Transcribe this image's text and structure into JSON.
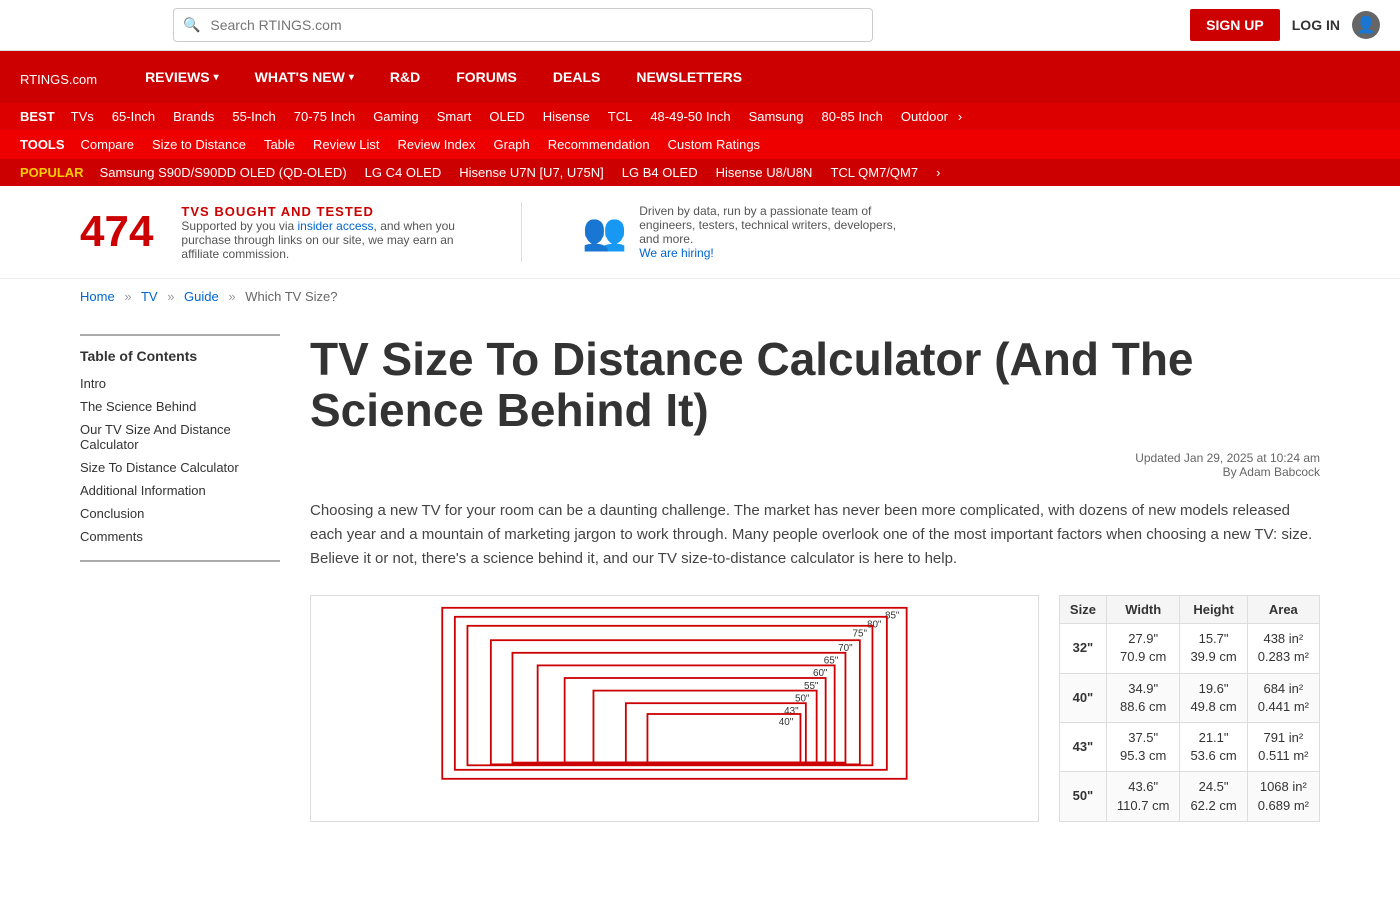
{
  "topbar": {
    "search_placeholder": "Search RTINGS.com",
    "signup_label": "SIGN UP",
    "login_label": "LOG IN"
  },
  "nav": {
    "logo": "RTINGS",
    "logo_suffix": ".com",
    "items": [
      {
        "label": "REVIEWS",
        "has_arrow": true
      },
      {
        "label": "WHAT'S NEW",
        "has_arrow": true
      },
      {
        "label": "R&D",
        "has_arrow": false
      },
      {
        "label": "FORUMS",
        "has_arrow": false
      },
      {
        "label": "DEALS",
        "has_arrow": false
      },
      {
        "label": "NEWSLETTERS",
        "has_arrow": false
      }
    ]
  },
  "best_nav": {
    "label": "BEST",
    "items": [
      "TVs",
      "65-Inch",
      "Brands",
      "55-Inch",
      "70-75 Inch",
      "Gaming",
      "Smart",
      "OLED",
      "Hisense",
      "TCL",
      "48-49-50 Inch",
      "Samsung",
      "80-85 Inch",
      "Outdoor"
    ]
  },
  "tools_nav": {
    "label": "TOOLS",
    "items": [
      "Compare",
      "Size to Distance",
      "Table",
      "Review List",
      "Review Index",
      "Graph",
      "Recommendation",
      "Custom Ratings"
    ]
  },
  "popular_nav": {
    "label": "POPULAR",
    "items": [
      "Samsung S90D/S90DD OLED (QD-OLED)",
      "LG C4 OLED",
      "Hisense U7N [U7, U75N]",
      "LG B4 OLED",
      "Hisense U8/U8N",
      "TCL QM7/QM7"
    ]
  },
  "stats": {
    "count": "474",
    "tvs_label": "TVS BOUGHT AND TESTED",
    "tvs_desc": "Supported by you via",
    "tvs_link": "insider access",
    "tvs_desc2": ", and when you purchase through links on our site, we may earn an affiliate commission.",
    "team_desc": "Driven by data, run by a passionate team of engineers, testers, technical writers, developers, and more.",
    "hire_label": "We are hiring!"
  },
  "breadcrumb": {
    "home": "Home",
    "tv": "TV",
    "guide": "Guide",
    "current": "Which TV Size?"
  },
  "article": {
    "title": "TV Size To Distance Calculator (And The Science Behind It)",
    "updated": "Updated Jan 29, 2025 at 10:24 am",
    "author": "By Adam Babcock",
    "intro": "Choosing a new TV for your room can be a daunting challenge. The market has never been more complicated, with dozens of new models released each year and a mountain of marketing jargon to work through. Many people overlook one of the most important factors when choosing a new TV: size. Believe it or not, there's a science behind it, and our TV size-to-distance calculator is here to help."
  },
  "toc": {
    "title": "Table of Contents",
    "items": [
      "Intro",
      "The Science Behind",
      "Our TV Size And Distance Calculator",
      "Size To Distance Calculator",
      "Additional Information",
      "Conclusion",
      "Comments"
    ]
  },
  "tv_sizes": {
    "labels": [
      "85\"",
      "80\"",
      "75\"",
      "70\"",
      "65\"",
      "60\"",
      "55\"",
      "50\"",
      "43\"",
      "40\""
    ],
    "diagram_labels": [
      "85\"",
      "80\"",
      "75\"",
      "70\"",
      "65\"",
      "60\"",
      "55\"",
      "50\"",
      "43\"",
      "40\""
    ]
  },
  "size_table": {
    "headers": [
      "Size",
      "Width",
      "Height",
      "Area"
    ],
    "rows": [
      {
        "size": "32\"",
        "width": "27.9\"\n70.9 cm",
        "height": "15.7\"\n39.9 cm",
        "area": "438 in²\n0.283 m²"
      },
      {
        "size": "40\"",
        "width": "34.9\"\n88.6 cm",
        "height": "19.6\"\n49.8 cm",
        "area": "684 in²\n0.441 m²"
      },
      {
        "size": "43\"",
        "width": "37.5\"\n95.3 cm",
        "height": "21.1\"\n53.6 cm",
        "area": "791 in²\n0.511 m²"
      },
      {
        "size": "50\"",
        "width": "43.6\"\n110.7 cm",
        "height": "24.5\"\n62.2 cm",
        "area": "1068 in²\n0.689 m²"
      }
    ]
  },
  "colors": {
    "brand_red": "#cc0000",
    "nav_red": "#cc0000",
    "link_blue": "#0066cc"
  }
}
